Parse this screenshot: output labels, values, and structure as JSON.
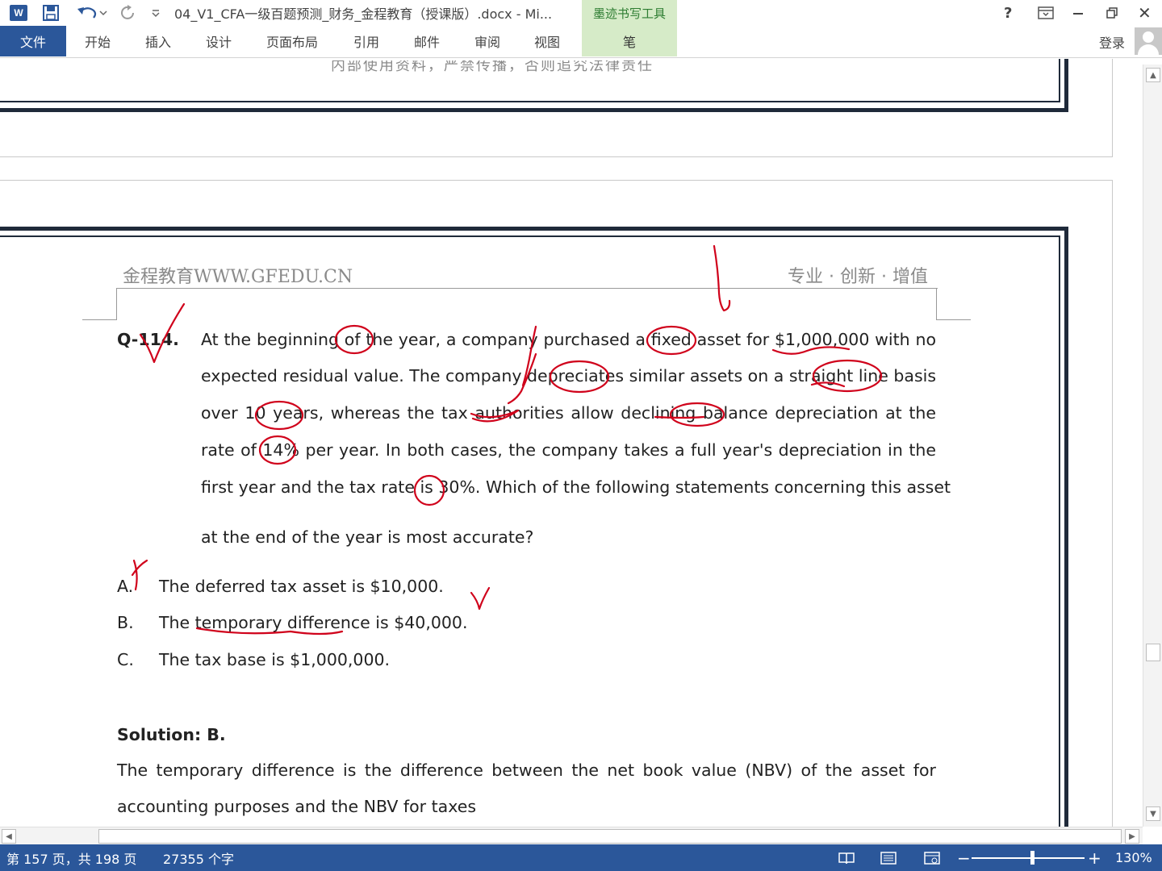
{
  "window": {
    "title": "04_V1_CFA一级百题预测_财务_金程教育（授课版）.docx - Mi...",
    "contextual_tab_title": "墨迹书写工具",
    "help": "?",
    "close": "✕",
    "login": "登录"
  },
  "ribbon": {
    "tabs": [
      "文件",
      "开始",
      "插入",
      "设计",
      "页面布局",
      "引用",
      "邮件",
      "审阅",
      "视图",
      "笔"
    ]
  },
  "document": {
    "cut_off_text": "内部使用资料，严禁传播，否则追究法律责任",
    "header_left": "金程教育WWW.GFEDU.CN",
    "header_right": "专业 · 创新 · 增值",
    "question_number": "Q-114.",
    "question_lines": [
      "At the beginning of the year, a company purchased a fixed asset for $1,000,000 with no",
      "expected residual value. The company depreciates similar assets on a straight line basis",
      "over 10 years, whereas the tax authorities allow declining balance depreciation at the",
      "rate of 14% per year. In both cases, the company takes a full year's depreciation in the",
      "first year and the tax rate is 30%. Which of the following statements concerning this asset",
      "at the end of the year is most accurate?"
    ],
    "options": [
      {
        "letter": "A.",
        "text": "The deferred tax asset is $10,000."
      },
      {
        "letter": "B.",
        "text": "The temporary difference is $40,000."
      },
      {
        "letter": "C.",
        "text": "The tax base is $1,000,000."
      }
    ],
    "solution_title": "Solution: B.",
    "solution_lines": [
      "The temporary difference is the difference between the net book value (NBV) of the asset for",
      "accounting purposes and the NBV for taxes"
    ]
  },
  "ink_color": "#d0021b",
  "status": {
    "page": "第 157 页，共 198 页",
    "words": "27355 个字",
    "zoom_out": "−",
    "zoom_in": "+",
    "zoom": "130%",
    "zoom_fraction": 0.54
  },
  "colors": {
    "word_blue": "#2b579a",
    "ink_tools_green": "#d6ebc8"
  }
}
